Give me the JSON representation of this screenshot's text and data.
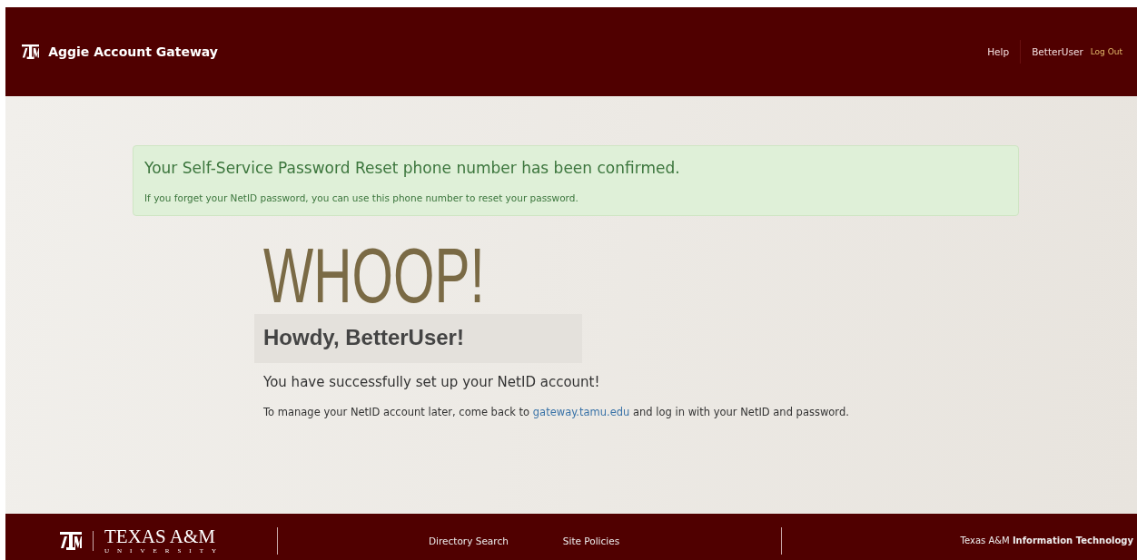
{
  "header": {
    "title": "Aggie Account Gateway",
    "help": "Help",
    "user": "BetterUser",
    "logout": "Log Out"
  },
  "alert": {
    "title": "Your Self-Service Password Reset phone number has been confirmed.",
    "message": "If you forget your NetID password, you can use this phone number to reset your password."
  },
  "hero": {
    "headline": "WHOOP!",
    "greeting": "Howdy, BetterUser!",
    "lead": "You have successfully set up your NetID account!",
    "note_before": "To manage your NetID account later, come back to",
    "note_link": "gateway.tamu.edu",
    "note_after": "and log in with your NetID and password."
  },
  "footer": {
    "wordmark": "TEXAS A&M",
    "wordmark_sub": "UNIVERSITY",
    "links": [
      "Directory Search",
      "Site Policies"
    ],
    "credit": "Texas A&M **Information Technology**"
  }
}
